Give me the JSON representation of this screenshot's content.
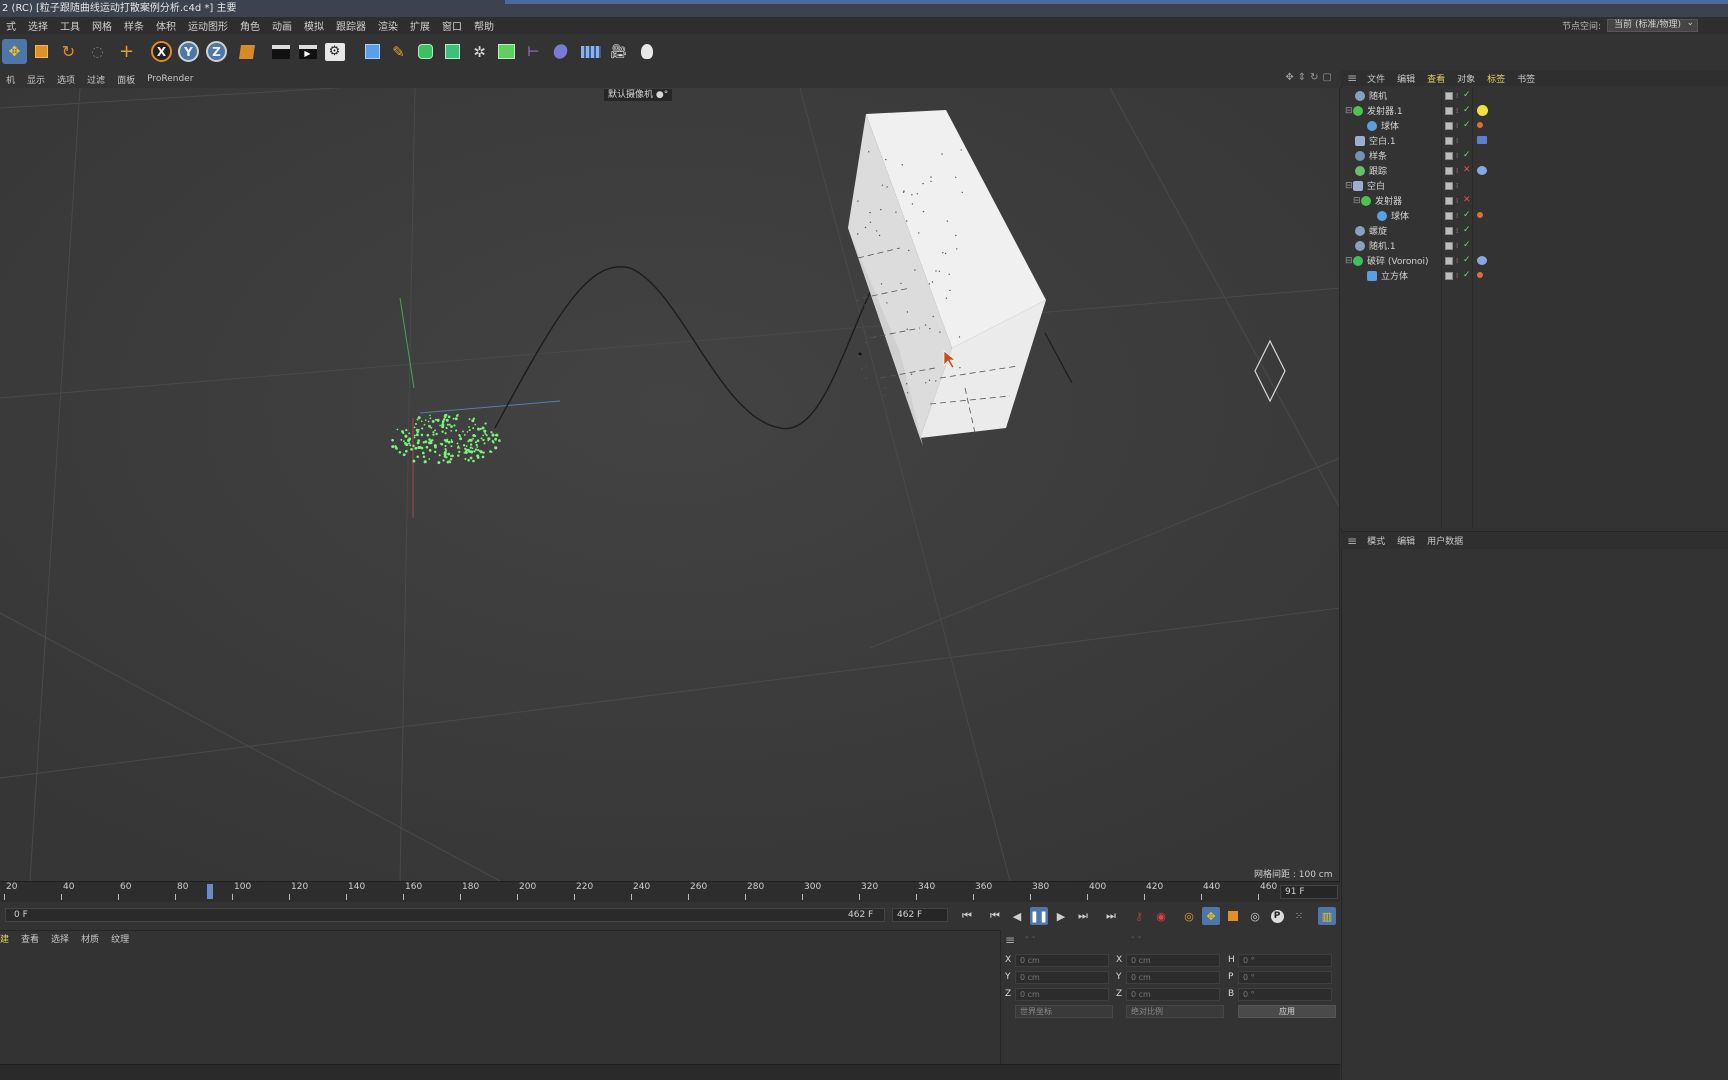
{
  "titlebar": {
    "text": "2 (RC)   [粒子跟随曲线运动打散案例分析.c4d *]   主要"
  },
  "menubar": {
    "items": [
      "式",
      "选择",
      "工具",
      "网格",
      "样条",
      "体积",
      "运动图形",
      "角色",
      "动画",
      "模拟",
      "跟踪器",
      "渲染",
      "扩展",
      "窗口",
      "帮助"
    ],
    "node_space_label": "节点空间:",
    "node_space_value": "当前 (标准/物理)"
  },
  "viewmenu": {
    "items": [
      "机",
      "显示",
      "选项",
      "过滤",
      "面板",
      "ProRender"
    ]
  },
  "viewport": {
    "camera_label": "默认摄像机 ●°",
    "grid_label": "网格间距 : 100 cm"
  },
  "object_manager": {
    "menu": [
      "文件",
      "编辑",
      "查看",
      "对象",
      "标签",
      "书签"
    ],
    "rows": [
      {
        "name": "随机",
        "indent": 0
      },
      {
        "name": "发射器.1",
        "indent": 0
      },
      {
        "name": "球体",
        "indent": 1
      },
      {
        "name": "空白.1",
        "indent": 0
      },
      {
        "name": "样条",
        "indent": 0
      },
      {
        "name": "跟踪",
        "indent": 0
      },
      {
        "name": "空白",
        "indent": 0
      },
      {
        "name": "发射器",
        "indent": 1
      },
      {
        "name": "球体",
        "indent": 2
      },
      {
        "name": "螺旋",
        "indent": 0
      },
      {
        "name": "随机.1",
        "indent": 0
      },
      {
        "name": "破碎 (Voronoi)",
        "indent": 0
      },
      {
        "name": "立方体",
        "indent": 1
      }
    ]
  },
  "attribute_manager": {
    "menu": [
      "模式",
      "编辑",
      "用户数据"
    ]
  },
  "timeline": {
    "ticks": [
      "20",
      "40",
      "60",
      "80",
      "100",
      "120",
      "140",
      "160",
      "180",
      "200",
      "220",
      "240",
      "260",
      "280",
      "300",
      "320",
      "340",
      "360",
      "380",
      "400",
      "420",
      "440",
      "460"
    ],
    "current_frame": "91 F",
    "range_start": "0 F",
    "range_end": "462 F",
    "range_end_field": "462 F"
  },
  "material_manager": {
    "menu": [
      "建",
      "查看",
      "选择",
      "材质",
      "纹理"
    ]
  },
  "coordinates": {
    "rows": [
      {
        "a": "X",
        "av": "0 cm",
        "b": "X",
        "bv": "0 cm",
        "c": "H",
        "cv": "0 °"
      },
      {
        "a": "Y",
        "av": "0 cm",
        "b": "Y",
        "bv": "0 cm",
        "c": "P",
        "cv": "0 °"
      },
      {
        "a": "Z",
        "av": "0 cm",
        "b": "Z",
        "bv": "0 cm",
        "c": "B",
        "cv": "0 °"
      }
    ],
    "mode_dropdown": "世界坐标",
    "scale_dropdown": "绝对比例",
    "apply_label": "应用"
  },
  "colors": {
    "selection_blue": "#4c77a8",
    "particle_green": "#7cf27c",
    "viewport_bg": "#3c3c3c"
  },
  "icons": [
    "move-icon",
    "scale-icon",
    "rotate-icon",
    "x-axis-icon",
    "y-axis-icon",
    "z-axis-icon",
    "cube-icon",
    "pen-icon",
    "light-icon",
    "camera-icon"
  ]
}
